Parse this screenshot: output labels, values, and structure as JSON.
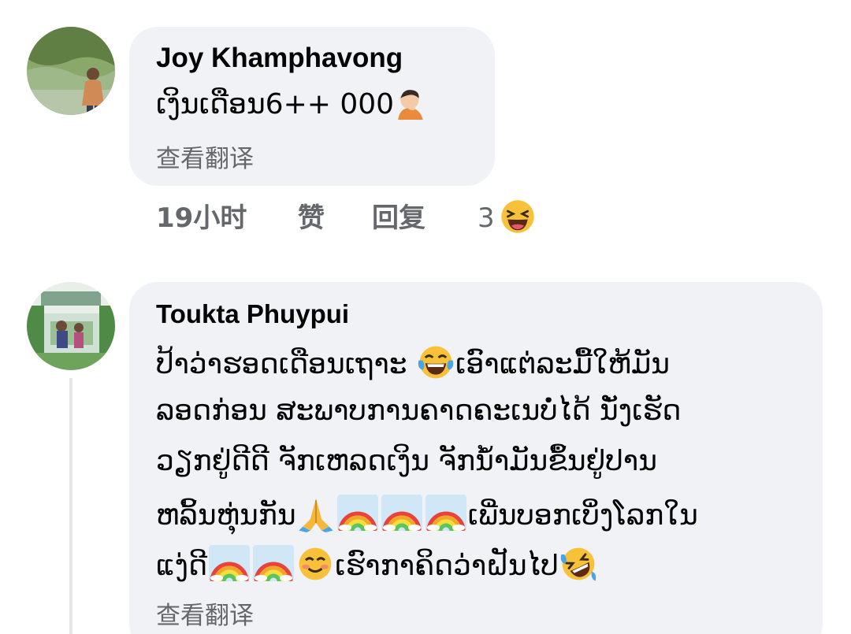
{
  "comments": [
    {
      "author": "Joy Khamphavong",
      "text_parts": [
        "ເງິນເດືອນ6++ 000"
      ],
      "trailing_emoji": "facepalm-person-icon",
      "translate_label": "查看翻译",
      "time": "19小时",
      "like_label": "赞",
      "reply_label": "回复",
      "reaction_count": "3",
      "reaction_emoji": "laughing-face-icon"
    },
    {
      "author": "Toukta Phuypui",
      "lines": [
        {
          "a": "ປ້າວ່າຮອດເດືອນເຖາະ ",
          "b": "ເອົາແຕ່ລະມື້ໃຫ້ມັນ"
        },
        {
          "a": "ລອດກ່ອນ ສະພາບການຄາດຄະເນບໍ່ໄດ້ ນັ່ງເຮັດ"
        },
        {
          "a": "ວຽກຢູ່ດີດີ ຈັກເຫລດເງິນ ຈັກນ້ຳມັນຂຶ້ນຢູ່ປານ"
        },
        {
          "a": "ຫລິ້ນຫຸ່ນກັນ",
          "b": "ເພີ່ນບອກເບິ່ງໂລກໃນ"
        },
        {
          "a": "ແງ່ດີ",
          "b": "ເຮົາກາຄິດວ່າຝັນໄປ"
        }
      ],
      "translate_label": "查看翻译"
    }
  ],
  "colors": {
    "bubble": "#f0f2f5",
    "meta": "#65676b",
    "text": "#050505"
  }
}
